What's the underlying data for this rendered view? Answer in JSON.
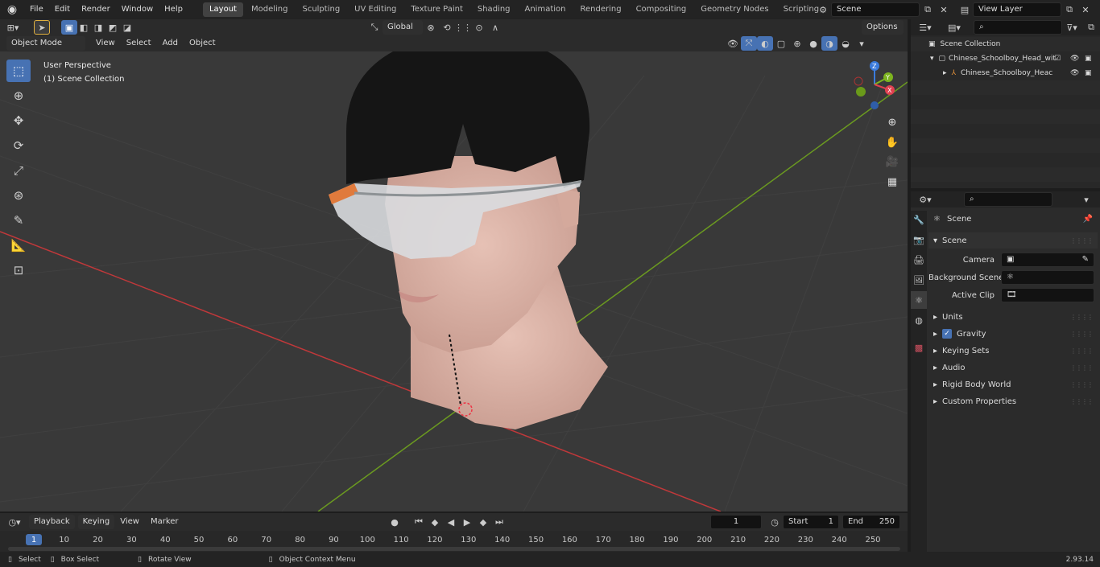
{
  "menus": [
    "File",
    "Edit",
    "Render",
    "Window",
    "Help"
  ],
  "workspaces": [
    "Layout",
    "Modeling",
    "Sculpting",
    "UV Editing",
    "Texture Paint",
    "Shading",
    "Animation",
    "Rendering",
    "Compositing",
    "Geometry Nodes",
    "Scripting"
  ],
  "active_workspace": "Layout",
  "scene_field": "Scene",
  "view_layer_field": "View Layer",
  "viewport": {
    "mode": "Object Mode",
    "menu": [
      "View",
      "Select",
      "Add",
      "Object"
    ],
    "transform_orientation": "Global",
    "options_label": "Options",
    "overlay_line1": "User Perspective",
    "overlay_line2": "(1) Scene Collection"
  },
  "tools": [
    "select-box",
    "cursor",
    "move",
    "rotate",
    "scale",
    "transform",
    "annotate",
    "measure",
    "add-cube"
  ],
  "gizmo_labels": [
    "Z",
    "Y",
    "X"
  ],
  "outliner": {
    "root": "Scene Collection",
    "item1": "Chinese_Schoolboy_Head_wit",
    "item2": "Chinese_Schoolboy_Heac"
  },
  "properties": {
    "header": "Scene",
    "section": "Scene",
    "camera_label": "Camera",
    "background_label": "Background Scene",
    "clip_label": "Active Clip",
    "panels": [
      "Units",
      "Gravity",
      "Keying Sets",
      "Audio",
      "Rigid Body World",
      "Custom Properties"
    ]
  },
  "timeline": {
    "menu": [
      "Playback",
      "Keying",
      "View",
      "Marker"
    ],
    "current_frame": "1",
    "start_label": "Start",
    "start_value": "1",
    "end_label": "End",
    "end_value": "250",
    "ticks": [
      "1",
      "10",
      "20",
      "30",
      "40",
      "50",
      "60",
      "70",
      "80",
      "90",
      "100",
      "110",
      "120",
      "130",
      "140",
      "150",
      "160",
      "170",
      "180",
      "190",
      "200",
      "210",
      "220",
      "230",
      "240",
      "250"
    ]
  },
  "status": {
    "select": "Select",
    "box_select": "Box Select",
    "rotate_view": "Rotate View",
    "context_menu": "Object Context Menu",
    "version": "2.93.14"
  },
  "colors": {
    "accent": "#4772b3",
    "x_axis": "#c0383a",
    "y_axis": "#6b9a20"
  }
}
